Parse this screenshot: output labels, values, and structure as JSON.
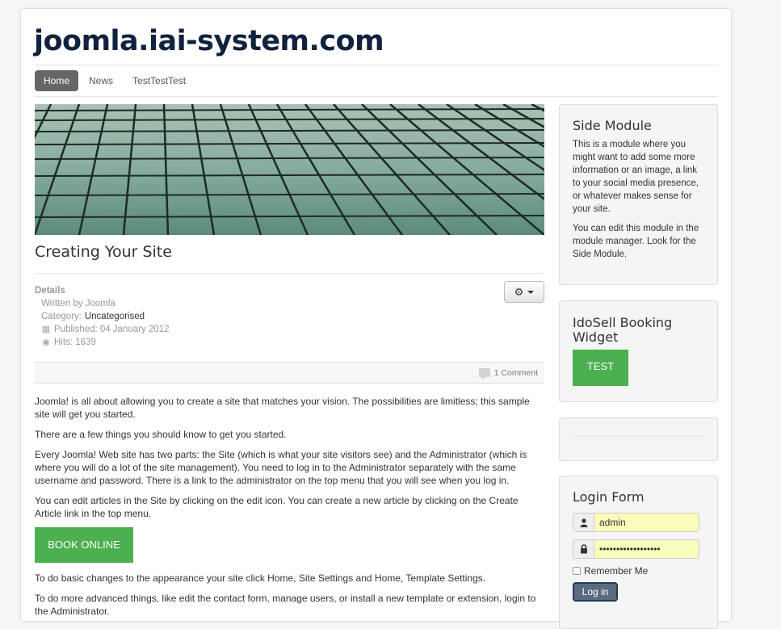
{
  "site": {
    "title": "joomla.iai-system.com"
  },
  "nav": {
    "items": [
      {
        "label": "Home",
        "active": true
      },
      {
        "label": "News",
        "active": false
      },
      {
        "label": "TestTestTest",
        "active": false
      }
    ]
  },
  "article": {
    "title": "Creating Your Site",
    "details": {
      "heading": "Details",
      "written_by": "Written by Joomla",
      "category_prefix": "Category: ",
      "category": "Uncategorised",
      "published": "Published: 04 January 2012",
      "hits": "Hits: 1639"
    },
    "comments": "1 Comment",
    "paragraphs": [
      "Joomla! is all about allowing you to create a site that matches your vision. The possibilities are limitless; this sample site will get you started.",
      "There are a few things you should know to get you started.",
      "Every Joomla! Web site has two parts: the Site (which is what your site visitors see) and the Administrator (which is where you will do a lot of the site management). You need to log in to the Administrator separately with the same username and password. There is a link to the administrator on the top menu that you will see when you log in.",
      "You can edit articles in the Site by clicking on the edit icon. You can create a new article by clicking on the Create Article link in the top menu."
    ],
    "book_button": "BOOK ONLINE",
    "paragraphs_after": [
      "To do basic changes to the appearance your site click Home, Site Settings and Home, Template Settings.",
      "To do more advanced things, like edit the contact form, manage users, or install a new template or extension, login to the Administrator."
    ]
  },
  "side_module": {
    "title": "Side Module",
    "p1": "This is a module where you might want to add some more information or an image, a link to your social media presence, or whatever makes sense for your site.",
    "p2": "You can edit this module in the module manager. Look for the Side Module."
  },
  "booking_widget": {
    "title": "IdoSell Booking Widget",
    "button": "TEST"
  },
  "login": {
    "title": "Login Form",
    "username": "admin",
    "password": "••••••••••••••••••",
    "remember_label": "Remember Me",
    "submit": "Log in"
  },
  "colors": {
    "accent_green": "#4caf50",
    "nav_active": "#666666",
    "input_autofill": "#fafcbb"
  }
}
